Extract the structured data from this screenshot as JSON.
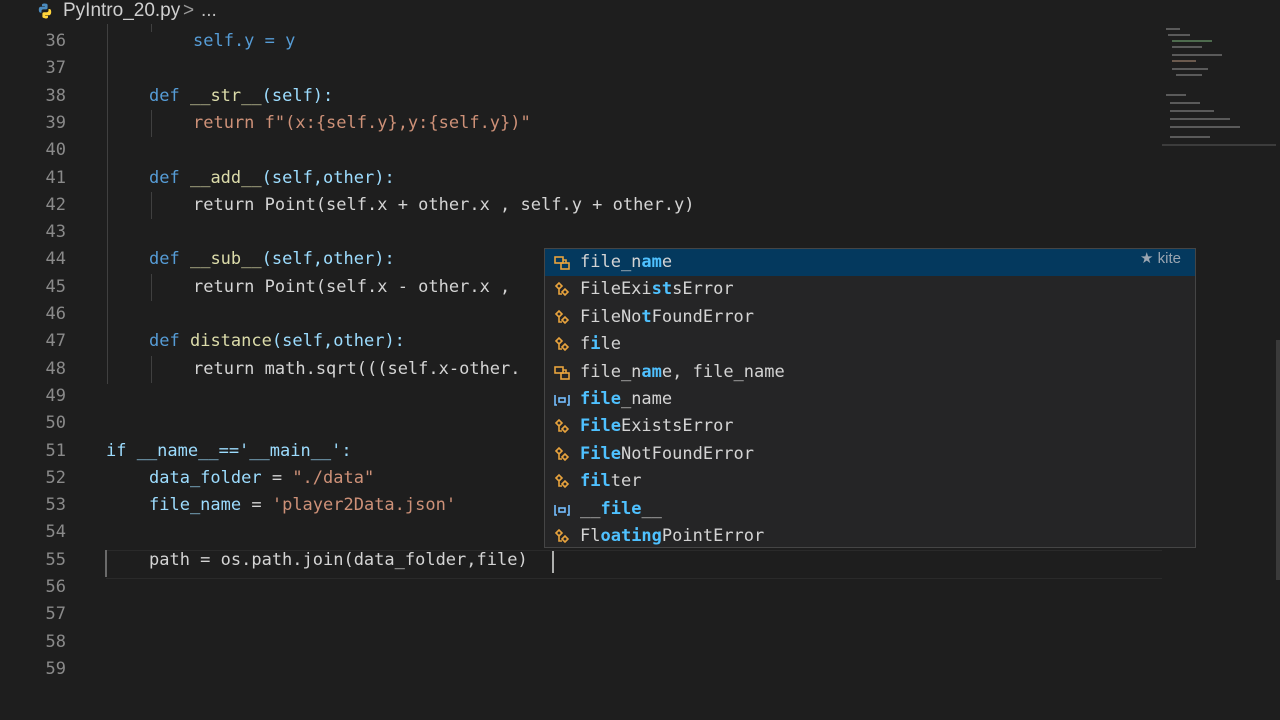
{
  "breadcrumb": {
    "file": "PyIntro_20.py",
    "separator": ">",
    "more": "..."
  },
  "lines": [
    {
      "n": "36"
    },
    {
      "n": "37"
    },
    {
      "n": "38"
    },
    {
      "n": "39"
    },
    {
      "n": "40"
    },
    {
      "n": "41"
    },
    {
      "n": "42"
    },
    {
      "n": "43"
    },
    {
      "n": "44"
    },
    {
      "n": "45"
    },
    {
      "n": "46"
    },
    {
      "n": "47"
    },
    {
      "n": "48"
    },
    {
      "n": "49"
    },
    {
      "n": "50"
    },
    {
      "n": "51"
    },
    {
      "n": "52"
    },
    {
      "n": "53"
    },
    {
      "n": "54"
    },
    {
      "n": "55"
    },
    {
      "n": "56"
    },
    {
      "n": "57"
    },
    {
      "n": "58"
    },
    {
      "n": "59"
    }
  ],
  "code": {
    "l36": "self.y = y",
    "l38_def": "def",
    "l38_name": "__str__",
    "l38_rest": "(self):",
    "l39": "return f\"(x:{self.y},y:{self.y})\"",
    "l41_def": "def",
    "l41_name": "__add__",
    "l41_rest": "(self,other):",
    "l42": "return Point(self.x + other.x , self.y + other.y)",
    "l44_def": "def",
    "l44_name": "__sub__",
    "l44_rest": "(self,other):",
    "l45": "return Point(self.x - other.x ,",
    "l47_def": "def",
    "l47_name": "distance",
    "l47_rest": "(self,other):",
    "l48": "return math.sqrt(((self.x-other.",
    "l51": "if __name__=='__main__':",
    "l52_var": "data_folder",
    "l52_eq": " = ",
    "l52_str": "\"./data\"",
    "l53_var": "file_name",
    "l53_eq": " = ",
    "l53_str": "'player2Data.json'",
    "l55": "path = os.path.join(data_folder,file)"
  },
  "suggest": {
    "brand": "★ kite",
    "items": [
      {
        "pre": "file_n",
        "hl": "am",
        "post": "e",
        "icon": "kite-icon"
      },
      {
        "pre": "FileExi",
        "hl": "st",
        "post": "sError",
        "icon": "class-icon"
      },
      {
        "pre": "FileNo",
        "hl": "t",
        "post": "FoundError",
        "icon": "class-icon"
      },
      {
        "pre": "f",
        "hl": "i",
        "post": "le",
        "icon": "class-icon"
      },
      {
        "pre": "file_n",
        "hl": "am",
        "post": "e, file_name",
        "icon": "kite-icon"
      },
      {
        "pre": "",
        "hl": "file",
        "post": "_name",
        "icon": "variable-icon"
      },
      {
        "pre": "",
        "hl": "File",
        "post": "ExistsError",
        "icon": "class-icon"
      },
      {
        "pre": "",
        "hl": "File",
        "post": "NotFoundError",
        "icon": "class-icon"
      },
      {
        "pre": "",
        "hl": "fil",
        "post": "ter",
        "icon": "class-icon"
      },
      {
        "pre": "__",
        "hl": "file",
        "post": "__",
        "icon": "variable-icon"
      },
      {
        "pre": "Fl",
        "hl": "oating",
        "post": "PointError",
        "icon": "class-icon"
      }
    ]
  }
}
